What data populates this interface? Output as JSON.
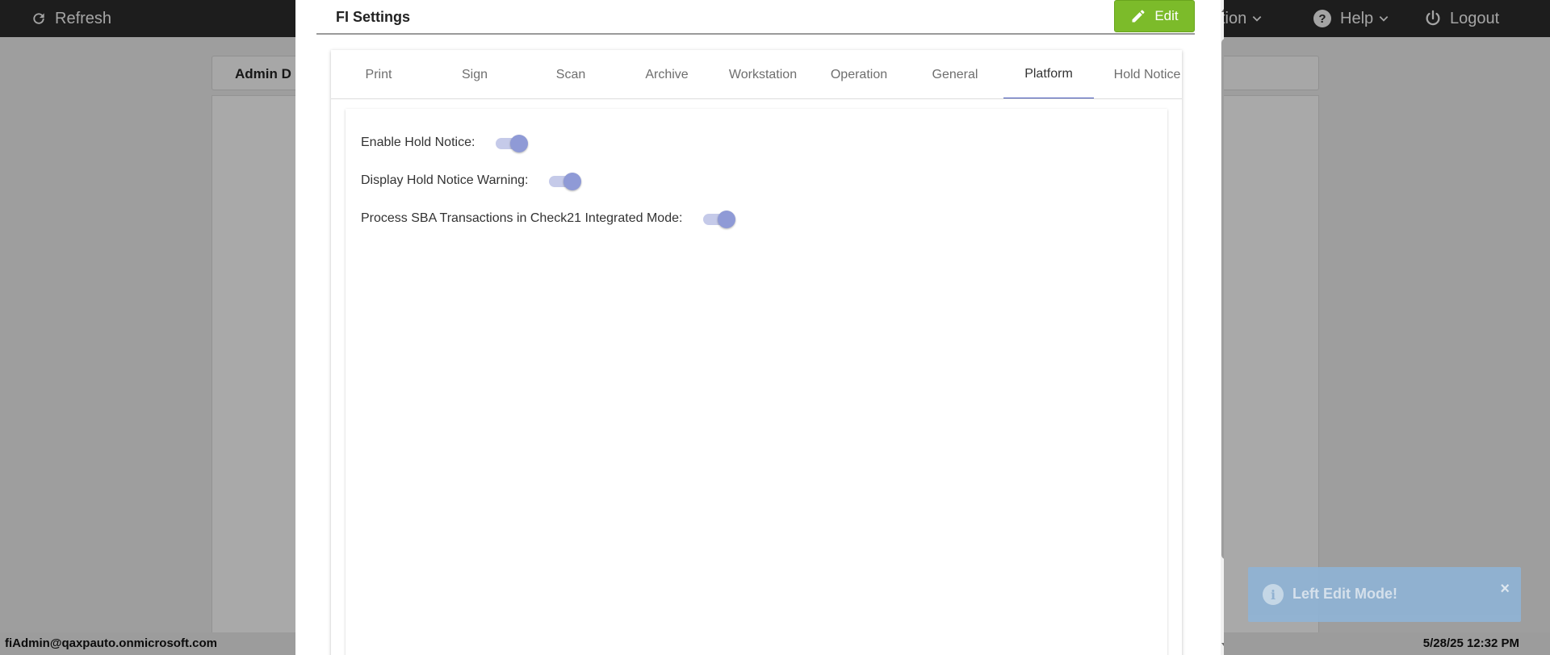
{
  "topbar": {
    "refresh_label": "Refresh",
    "partial_menu_label": "tion",
    "help_label": "Help",
    "logout_label": "Logout"
  },
  "background": {
    "panel_title": "Admin D"
  },
  "statusbar": {
    "user": "fiAdmin@qaxpauto.onmicrosoft.com",
    "datetime": "5/28/25 12:32 PM"
  },
  "modal": {
    "title": "FI Settings",
    "edit_label": "Edit",
    "tabs": [
      {
        "label": "Print",
        "active": false
      },
      {
        "label": "Sign",
        "active": false
      },
      {
        "label": "Scan",
        "active": false
      },
      {
        "label": "Archive",
        "active": false
      },
      {
        "label": "Workstation",
        "active": false
      },
      {
        "label": "Operation",
        "active": false
      },
      {
        "label": "General",
        "active": false
      },
      {
        "label": "Platform",
        "active": true
      },
      {
        "label": "Hold Notice",
        "active": false
      }
    ],
    "settings": [
      {
        "label": "Enable Hold Notice:",
        "enabled": true
      },
      {
        "label": "Display Hold Notice Warning:",
        "enabled": true
      },
      {
        "label": "Process SBA Transactions in Check21 Integrated Mode:",
        "enabled": true
      }
    ]
  },
  "toast": {
    "message": "Left Edit Mode!",
    "close_symbol": "×",
    "icon": "info-icon"
  },
  "colors": {
    "accent": "#3f51b5",
    "edit_button": "#7cbb2a",
    "toggle_track": "#c5cae9",
    "toggle_knob": "#8f9ad6",
    "toast": "#8fb4d6",
    "topbar": "#2b2b2b"
  }
}
